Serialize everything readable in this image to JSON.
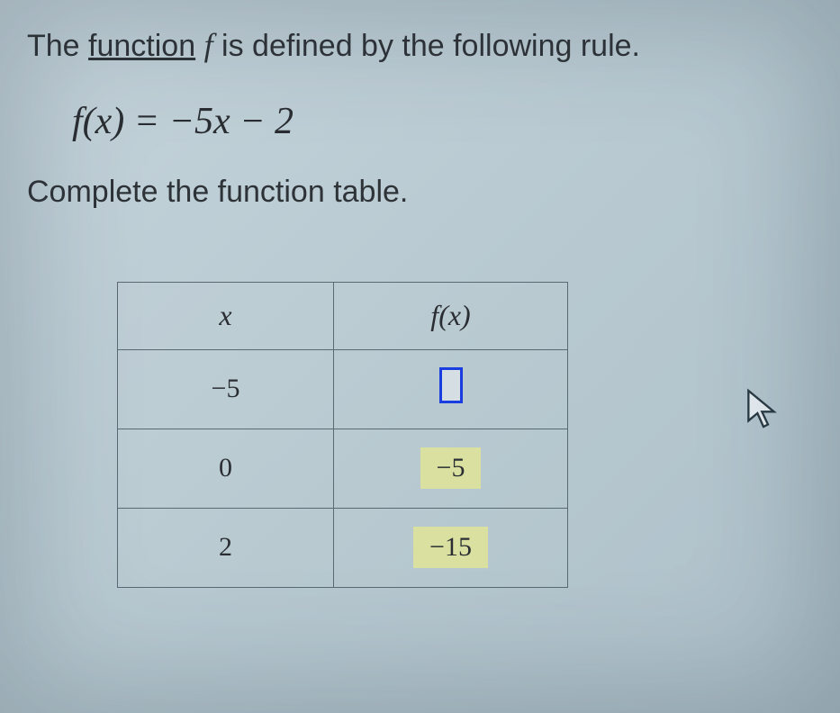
{
  "intro": {
    "prefix": "The ",
    "link_text": "function",
    "mid": " ",
    "var": "f",
    "suffix": " is defined by the following rule."
  },
  "formula": "f(x) = −5x − 2",
  "instruction": "Complete the function table.",
  "table": {
    "headers": {
      "x": "x",
      "fx": "f(x)"
    },
    "rows": [
      {
        "x": "−5",
        "fx": "",
        "input": true
      },
      {
        "x": "0",
        "fx": "−5",
        "chip": true
      },
      {
        "x": "2",
        "fx": "−15",
        "chip": true
      }
    ]
  }
}
